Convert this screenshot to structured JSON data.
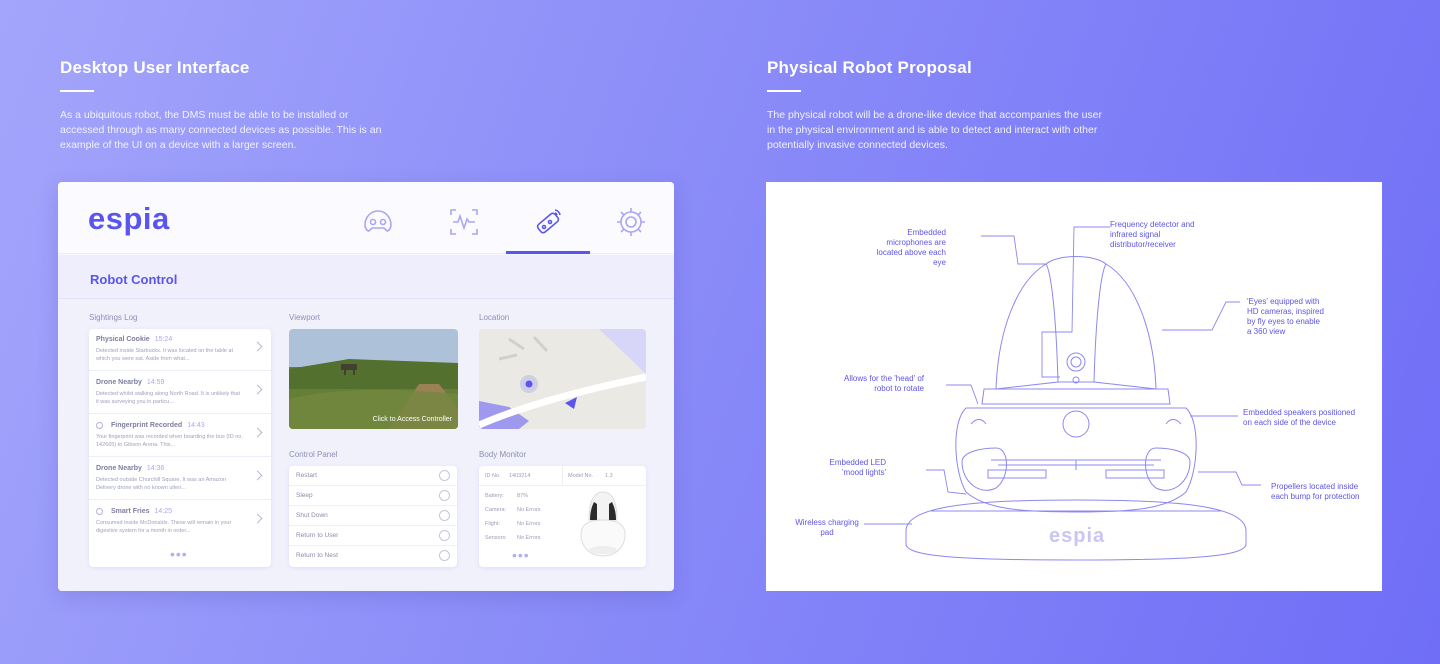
{
  "left": {
    "heading": "Desktop User Interface",
    "intro": "As a ubiquitous robot, the DMS must be able to be installed or accessed through as many connected devices as possible. This is an example of the UI on a device with a larger screen."
  },
  "right": {
    "heading": "Physical Robot Proposal",
    "intro": "The physical robot will be a drone-like device that accompanies the user in the physical environment and is able to detect and interact with other potentially invasive connected devices."
  },
  "app": {
    "logo": "espia",
    "nav": [
      {
        "icon": "sightings-icon"
      },
      {
        "icon": "monitor-icon"
      },
      {
        "icon": "remote-control-icon",
        "active": true
      },
      {
        "icon": "gear-icon"
      }
    ],
    "section_title": "Robot Control",
    "sightings": {
      "label": "Sightings Log",
      "items": [
        {
          "title": "Physical Cookie",
          "time": "15:24",
          "text": "Detected inside Starbucks. It was located on the table at which you were sat. Aside from what..."
        },
        {
          "title": "Drone Nearby",
          "time": "14:59",
          "text": "Detected whilst walking along North Road. It is unlikely that it was surveying you in particu..."
        },
        {
          "title": "Fingerprint Recorded",
          "time": "14:43",
          "text": "Your fingerprint was recorded when boarding the bus (ID no. 142665) to Gibson Arena. This...",
          "warn": true
        },
        {
          "title": "Drone Nearby",
          "time": "14:36",
          "text": "Detected outside Churchill Square. It was an Amazon Delivery drone with no known ulteri..."
        },
        {
          "title": "Smart Fries",
          "time": "14:25",
          "text": "Consumed inside McDonalds. These will remain in your digestive system for a month in order...",
          "warn": true
        }
      ],
      "more": "•••"
    },
    "viewport": {
      "label": "Viewport",
      "caption": "Click to Access Controller"
    },
    "location": {
      "label": "Location"
    },
    "control_panel": {
      "label": "Control Panel",
      "items": [
        "Restart",
        "Sleep",
        "Shut Down",
        "Return to User",
        "Return to Nest"
      ]
    },
    "body_monitor": {
      "label": "Body Monitor",
      "id_label": "ID No.",
      "id_value": "1403214",
      "model_label": "Model No.",
      "model_value": "1.3",
      "rows": [
        {
          "k": "Battery:",
          "v": "87%"
        },
        {
          "k": "Camera:",
          "v": "No Errors"
        },
        {
          "k": "Flight:",
          "v": "No Errors"
        },
        {
          "k": "Sensors:",
          "v": "No Errors"
        }
      ],
      "more": "•••"
    }
  },
  "robot": {
    "base_logo": "espia",
    "annotations": {
      "mics": "Embedded microphones are located above each eye",
      "freq": "Frequency detector and infrared signal distributor/receiver",
      "eyes": "'Eyes' equipped with HD cameras, inspired by fly eyes to enable a 360 view",
      "head": "Allows for the 'head' of robot to rotate",
      "speakers": "Embedded speakers positioned on each side of the device",
      "led": "Embedded LED 'mood lights'",
      "props": "Propellers located inside each bump for protection",
      "pad": "Wireless charging pad"
    }
  },
  "colors": {
    "accent": "#5a55ee",
    "bg_start": "#a3a5fb",
    "bg_end": "#6f6ef7",
    "line": "#7c78ee"
  }
}
